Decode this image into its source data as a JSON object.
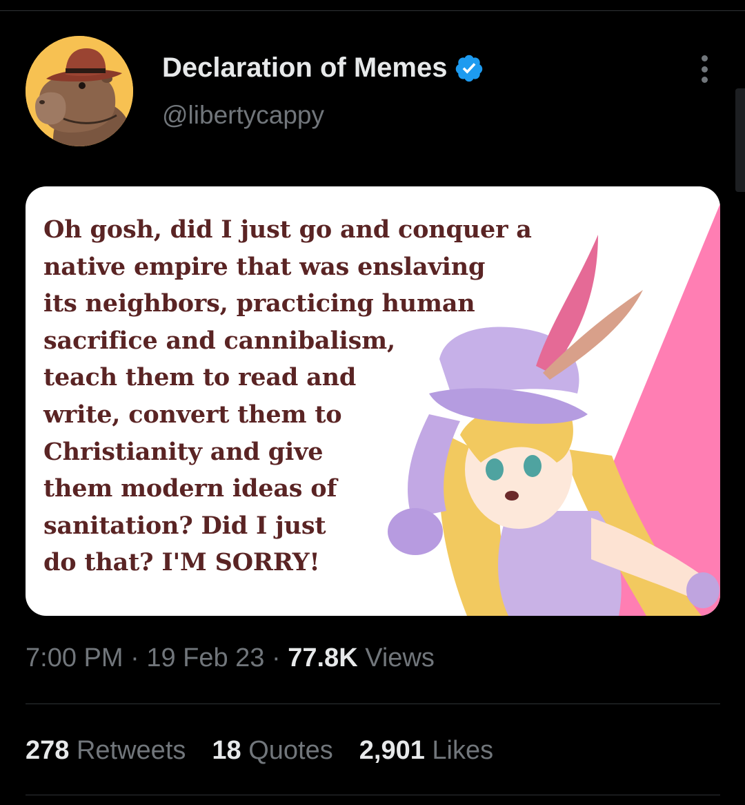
{
  "tweet": {
    "author": {
      "display_name": "Declaration of Memes",
      "handle": "@libertycappy",
      "verified": true,
      "avatar_bg": "#f7c152"
    },
    "media": {
      "meme_text": "Oh gosh, did I just go and conquer a\nnative empire that was enslaving\nits neighbors, practicing human\nsacrifice and cannibalism,\nteach them to read and\nwrite, convert them to\nChristianity and give\nthem modern ideas of\nsanitation? Did I just\ndo that? I'M SORRY!",
      "text_color": "#5a2424",
      "accent_pink": "#ff7eb3"
    },
    "meta": {
      "time": "7:00 PM",
      "separator": "·",
      "date": "19 Feb 23",
      "views_count": "77.8K",
      "views_label": "Views"
    },
    "stats": {
      "retweets": {
        "count": "278",
        "label": "Retweets"
      },
      "quotes": {
        "count": "18",
        "label": "Quotes"
      },
      "likes": {
        "count": "2,901",
        "label": "Likes"
      }
    }
  },
  "colors": {
    "background": "#000000",
    "primary_text": "#e7e9ea",
    "secondary_text": "#71767b",
    "divider": "#2f3336",
    "verified_blue": "#1d9bf0"
  }
}
